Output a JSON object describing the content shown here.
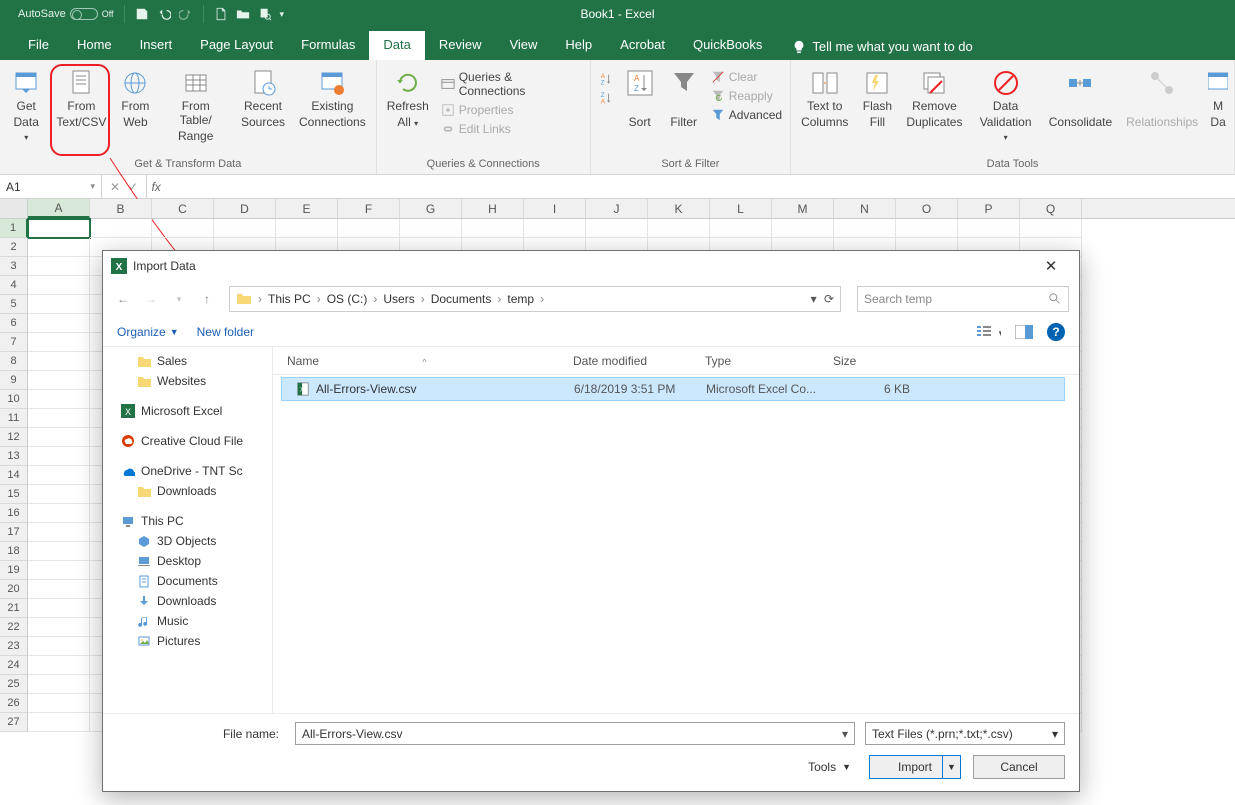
{
  "titlebar": {
    "autosave": "AutoSave",
    "off": "Off",
    "title": "Book1  -  Excel"
  },
  "tabs": [
    "File",
    "Home",
    "Insert",
    "Page Layout",
    "Formulas",
    "Data",
    "Review",
    "View",
    "Help",
    "Acrobat",
    "QuickBooks"
  ],
  "active_tab_index": 5,
  "tellme_text": "Tell me what you want to do",
  "ribbon": {
    "groups": [
      {
        "label": "Get & Transform Data",
        "items": [
          {
            "lines": [
              "Get",
              "Data"
            ],
            "dd": true,
            "icon": "getdata"
          },
          {
            "lines": [
              "From",
              "Text/CSV"
            ],
            "icon": "fromtext",
            "hl": true
          },
          {
            "lines": [
              "From",
              "Web"
            ],
            "icon": "fromweb"
          },
          {
            "lines": [
              "From Table/",
              "Range"
            ],
            "icon": "fromtable"
          },
          {
            "lines": [
              "Recent",
              "Sources"
            ],
            "icon": "recent"
          },
          {
            "lines": [
              "Existing",
              "Connections"
            ],
            "icon": "existing"
          }
        ]
      },
      {
        "label": "Queries & Connections",
        "items": [
          {
            "lines": [
              "Refresh",
              "All"
            ],
            "dd": true,
            "icon": "refresh"
          }
        ],
        "stack": [
          {
            "label": "Queries & Connections",
            "icon": "qc",
            "disabled": false
          },
          {
            "label": "Properties",
            "icon": "props",
            "disabled": true
          },
          {
            "label": "Edit Links",
            "icon": "links",
            "disabled": true
          }
        ]
      },
      {
        "label": "Sort & Filter",
        "items": [
          {
            "lines": [
              "",
              "Sort"
            ],
            "icon": "sortbox",
            "pre_icons": [
              "az",
              "za"
            ]
          },
          {
            "lines": [
              "",
              "Filter"
            ],
            "icon": "filter"
          }
        ],
        "stack": [
          {
            "label": "Clear",
            "icon": "clear",
            "disabled": true
          },
          {
            "label": "Reapply",
            "icon": "reapply",
            "disabled": true
          },
          {
            "label": "Advanced",
            "icon": "adv",
            "disabled": false
          }
        ]
      },
      {
        "label": "Data Tools",
        "items": [
          {
            "lines": [
              "Text to",
              "Columns"
            ],
            "icon": "t2c"
          },
          {
            "lines": [
              "Flash",
              "Fill"
            ],
            "icon": "flash"
          },
          {
            "lines": [
              "Remove",
              "Duplicates"
            ],
            "icon": "dupes"
          },
          {
            "lines": [
              "Data",
              "Validation"
            ],
            "dd": true,
            "icon": "valid"
          },
          {
            "lines": [
              "",
              "Consolidate"
            ],
            "icon": "consol"
          },
          {
            "lines": [
              "",
              "Relationships"
            ],
            "icon": "rel",
            "disabled": true
          },
          {
            "lines": [
              "M",
              "Da"
            ],
            "icon": "manage",
            "cut": true
          }
        ]
      }
    ]
  },
  "namebox": "A1",
  "columns": [
    "A",
    "B",
    "C",
    "D",
    "E",
    "F",
    "G",
    "H",
    "I",
    "J",
    "K",
    "L",
    "M",
    "N",
    "O",
    "P",
    "Q"
  ],
  "rowcount": 27,
  "dialog": {
    "title": "Import Data",
    "breadcrumb": [
      "This PC",
      "OS (C:)",
      "Users",
      "Documents",
      "temp"
    ],
    "search_placeholder": "Search temp",
    "organize": "Organize",
    "newfolder": "New folder",
    "cols": {
      "name": "Name",
      "date": "Date modified",
      "type": "Type",
      "size": "Size"
    },
    "tree": [
      {
        "label": "Sales",
        "icon": "folder",
        "lvl": 1
      },
      {
        "label": "Websites",
        "icon": "folder",
        "lvl": 1
      },
      {
        "label": "Microsoft Excel",
        "icon": "excel",
        "lvl": 0,
        "sect": true
      },
      {
        "label": "Creative Cloud File",
        "icon": "cc",
        "lvl": 0,
        "sect": true
      },
      {
        "label": "OneDrive - TNT Sc",
        "icon": "onedrive",
        "lvl": 0,
        "sect": true
      },
      {
        "label": "Downloads",
        "icon": "folder",
        "lvl": 1
      },
      {
        "label": "This PC",
        "icon": "thispc",
        "lvl": 0,
        "sect": true
      },
      {
        "label": "3D Objects",
        "icon": "3d",
        "lvl": 1
      },
      {
        "label": "Desktop",
        "icon": "desktop",
        "lvl": 1
      },
      {
        "label": "Documents",
        "icon": "docs",
        "lvl": 1
      },
      {
        "label": "Downloads",
        "icon": "dl",
        "lvl": 1
      },
      {
        "label": "Music",
        "icon": "music",
        "lvl": 1
      },
      {
        "label": "Pictures",
        "icon": "pics",
        "lvl": 1
      }
    ],
    "file": {
      "name": "All-Errors-View.csv",
      "date": "6/18/2019 3:51 PM",
      "type": "Microsoft Excel Co...",
      "size": "6 KB"
    },
    "filename_label": "File name:",
    "filename_value": "All-Errors-View.csv",
    "filetype": "Text Files (*.prn;*.txt;*.csv)",
    "tools": "Tools",
    "import_btn": "Import",
    "cancel_btn": "Cancel"
  }
}
